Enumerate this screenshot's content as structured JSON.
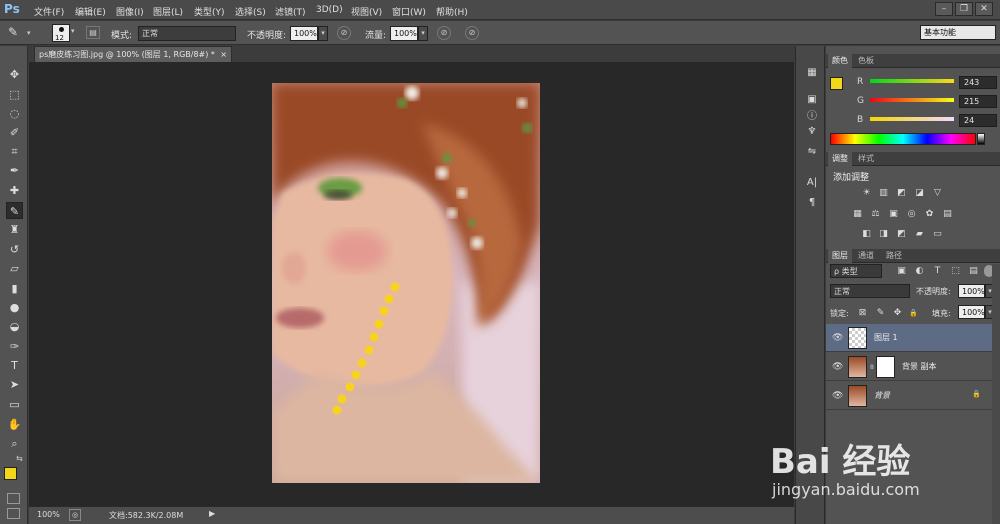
{
  "app": {
    "logo": "Ps"
  },
  "menu": [
    "文件(F)",
    "编辑(E)",
    "图像(I)",
    "图层(L)",
    "类型(Y)",
    "选择(S)",
    "滤镜(T)",
    "3D(D)",
    "视图(V)",
    "窗口(W)",
    "帮助(H)"
  ],
  "window_buttons": [
    "–",
    "❐",
    "✕"
  ],
  "options": {
    "brush_size": "12",
    "mode_label": "模式:",
    "mode_value": "正常",
    "opacity_label": "不透明度:",
    "opacity_value": "100%",
    "flow_label": "流量:",
    "flow_value": "100%",
    "workspace": "基本功能"
  },
  "document": {
    "tab_title": "ps磨皮练习图.jpg @ 100% (图层 1, RGB/8#) *",
    "close": "×"
  },
  "status": {
    "zoom": "100%",
    "doc_size": "文档:582.3K/2.08M"
  },
  "color_panel": {
    "tabs": [
      "颜色",
      "色板"
    ],
    "channels": [
      {
        "name": "R",
        "value": "243"
      },
      {
        "name": "G",
        "value": "215"
      },
      {
        "name": "B",
        "value": "24"
      }
    ],
    "foreground": "#f3d718",
    "background": "#000000"
  },
  "adjust_panel": {
    "tabs": [
      "调整",
      "样式"
    ],
    "heading": "添加调整",
    "row1": [
      "☀",
      "▥",
      "◩",
      "◪",
      "▽"
    ],
    "row2": [
      "▦",
      "⚖",
      "▣",
      "◎",
      "✿",
      "▤"
    ],
    "row3": [
      "◧",
      "◨",
      "◩",
      "▰",
      "▭"
    ]
  },
  "layers_panel": {
    "tabs": [
      "图层",
      "通道",
      "路径"
    ],
    "filter_label": "ρ 类型",
    "filter_icons": [
      "▣",
      "◐",
      "T",
      "⬚",
      "▤"
    ],
    "blend_mode": "正常",
    "opacity_label": "不透明度:",
    "opacity_value": "100%",
    "lock_label": "锁定:",
    "lock_icons": [
      "⊠",
      "✎",
      "✥",
      "🔒"
    ],
    "fill_label": "填充:",
    "fill_value": "100%",
    "layers": [
      {
        "name": "图层 1",
        "selected": true
      },
      {
        "name": "背景 副本",
        "selected": false
      },
      {
        "name": "背景",
        "selected": false
      }
    ]
  },
  "watermark": {
    "text": "Bai 经验",
    "sub": "jingyan.baidu.com"
  }
}
